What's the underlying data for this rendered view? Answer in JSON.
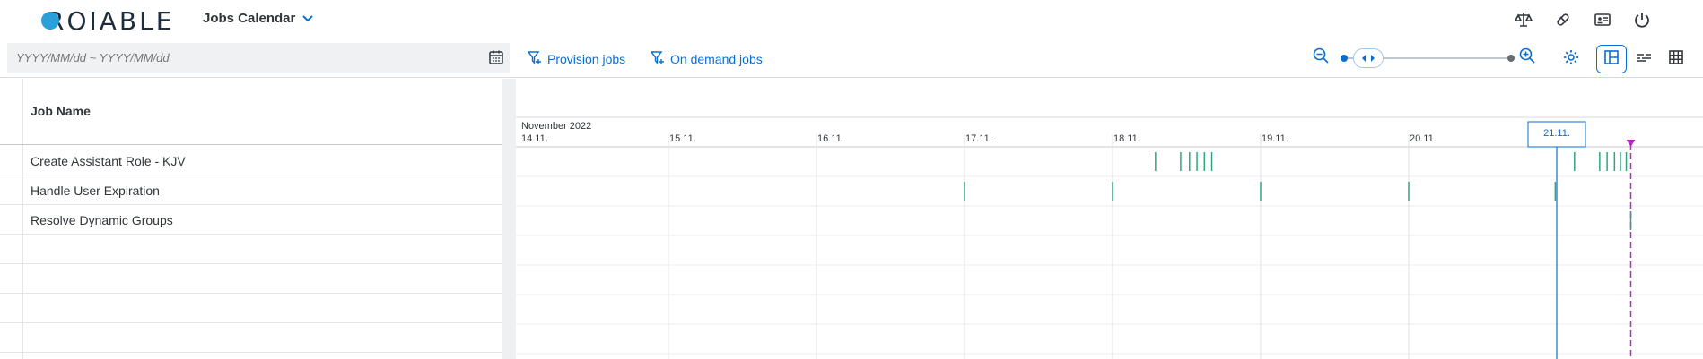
{
  "header": {
    "logo_text": "ROIABLE",
    "app_title": "Jobs Calendar",
    "icons": [
      "scale-icon",
      "pill-icon",
      "id-card-icon",
      "power-icon"
    ]
  },
  "toolbar": {
    "date_placeholder": "YYYY/MM/dd ~ YYYY/MM/dd",
    "provision_label": "Provision jobs",
    "on_demand_label": "On demand jobs",
    "zoom_level": 0.1,
    "active_view": "gantt-view"
  },
  "table": {
    "column_header": "Job Name",
    "rows": [
      "Create Assistant Role - KJV",
      "Handle User Expiration",
      "Resolve Dynamic Groups"
    ],
    "empty_rows": 4
  },
  "timeline": {
    "month_label": "November 2022",
    "days": [
      "14.11.",
      "15.11.",
      "16.11.",
      "17.11.",
      "18.11.",
      "19.11.",
      "20.11.",
      "21.11."
    ],
    "today_label": "21.11.",
    "today_day_fraction": 7.0,
    "now_day_fraction": 7.5,
    "accent": "#0a6ed1",
    "now_color": "#b22fc4",
    "job_color": "#2aa878",
    "jobs": [
      {
        "row": 0,
        "day_positions": [
          4.29,
          4.46,
          4.52,
          4.57,
          4.62,
          4.67,
          7.12,
          7.29,
          7.34,
          7.39,
          7.43,
          7.47
        ]
      },
      {
        "row": 1,
        "day_positions": [
          3.0,
          4.0,
          5.0,
          6.0,
          6.99
        ]
      },
      {
        "row": 2,
        "day_positions": [
          7.5
        ]
      }
    ]
  }
}
